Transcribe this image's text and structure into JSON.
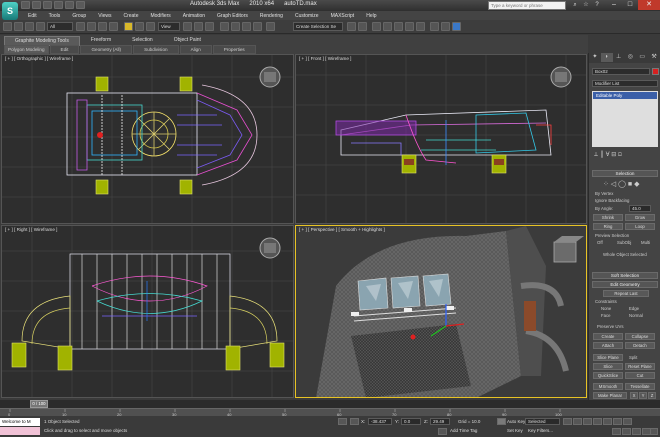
{
  "titlebar": {
    "app_logo": "S",
    "app_title": "Autodesk 3ds Max",
    "version": "2010 x64",
    "file": "autoTD.max",
    "search_placeholder": "Type a keyword or phrase"
  },
  "menu": [
    "Edit",
    "Tools",
    "Group",
    "Views",
    "Create",
    "Modifiers",
    "Animation",
    "Graph Editors",
    "Rendering",
    "Customize",
    "MAXScript",
    "Help"
  ],
  "toolbar": {
    "selection_filter": "All",
    "ref_coord": "View",
    "named_selection": "Create Selection Se"
  },
  "ribbon": {
    "tabs": [
      "Graphite Modeling Tools",
      "Freeform",
      "Selection",
      "Object Paint"
    ],
    "panels": [
      "Polygon Modeling",
      "Edit",
      "Geometry (All)",
      "Subdivision",
      "Align",
      "Properties"
    ]
  },
  "viewports": {
    "top_left": "[ + ] [ Orthographic ] [ Wireframe ]",
    "top_right": "[ + ] [ Front ] [ Wireframe ]",
    "bottom_left": "[ + ] [ Right ] [ Wireframe ]",
    "bottom_right": "[ + ] [ Perspective ] [ Smooth + Highlights ]"
  },
  "command_panel": {
    "object_name": "Box02",
    "modifier_list": "Modifier List",
    "stack_item": "Editable Poly",
    "selection": {
      "title": "Selection",
      "by_vertex": "By Vertex",
      "ignore_backfacing": "Ignore Backfacing",
      "by_angle": "By Angle:",
      "angle_value": "45.0",
      "shrink": "Shrink",
      "grow": "Grow",
      "ring": "Ring",
      "loop": "Loop",
      "preview": "Preview Selection",
      "off": "Off",
      "subobj": "SubObj",
      "multi": "Multi",
      "status": "Whole Object Selected"
    },
    "soft_selection": "Soft Selection",
    "edit_geometry": {
      "title": "Edit Geometry",
      "repeat_last": "Repeat Last",
      "constraints": "Constraints",
      "none": "None",
      "edge": "Edge",
      "face": "Face",
      "normal": "Normal",
      "preserve_uvs": "Preserve UVs",
      "create": "Create",
      "collapse": "Collapse",
      "attach": "Attach",
      "detach": "Detach",
      "slice_plane": "Slice Plane",
      "split": "Split",
      "slice": "Slice",
      "reset_plane": "Reset Plane",
      "quickslice": "QuickSlice",
      "cut": "Cut",
      "msmooth": "MSmooth",
      "tessellate": "Tessellate",
      "make_planar": "Make Planar",
      "x": "X",
      "y": "Y",
      "z": "Z"
    }
  },
  "timeslider": {
    "frame": "0 / 100",
    "ticks": [
      "0",
      "10",
      "20",
      "30",
      "40",
      "50",
      "60",
      "70",
      "80",
      "90",
      "100"
    ]
  },
  "status": {
    "maxscript": "Welcome to M",
    "selected": "1 Object Selected",
    "prompt": "Click and drag to select and move objects",
    "x": "-38.437",
    "y": "0.0",
    "z": "29.49",
    "grid": "Grid = 10.0",
    "add_time_tag": "Add Time Tag",
    "auto_key": "Auto Key",
    "set_key": "Set Key",
    "key_selected": "Selected",
    "key_filters": "Key Filters..."
  }
}
